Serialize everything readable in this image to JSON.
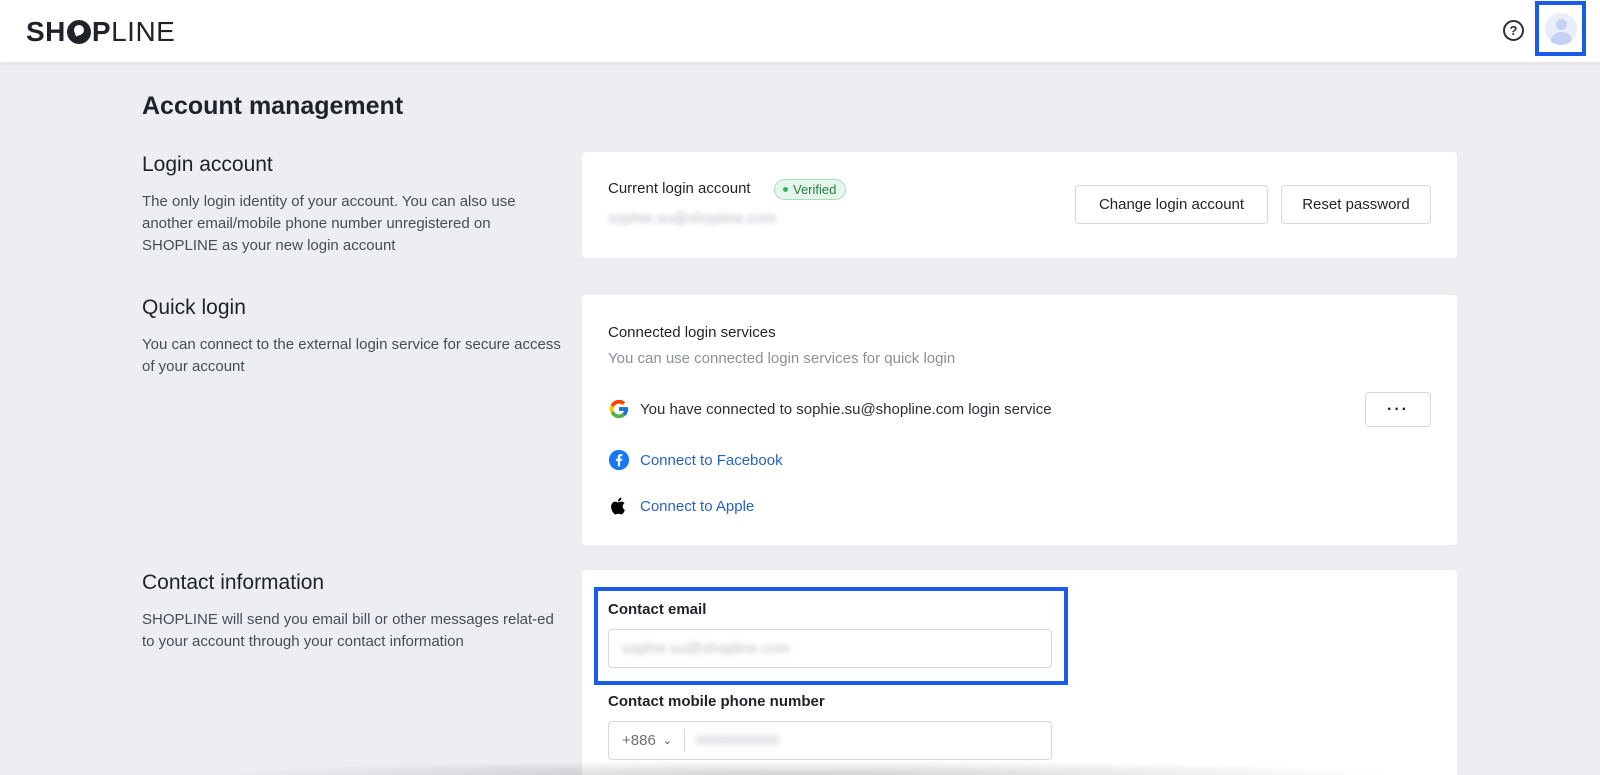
{
  "header": {
    "logo_bold_left": "SH",
    "logo_bold_right": "P",
    "logo_light": "LINE",
    "help_icon_glyph": "?",
    "accent_color": "#1a5ce8"
  },
  "page": {
    "title": "Account management"
  },
  "login_account": {
    "title": "Login account",
    "description": "The only login identity of your account. You can also use another email/mobile phone number unregistered on SHOPLINE as your new login account",
    "current_label": "Current login account",
    "verified_badge": "Verified",
    "email_masked": "sophie.su@shopline.com",
    "change_button": "Change login account",
    "reset_button": "Reset password"
  },
  "quick_login": {
    "title": "Quick login",
    "description": "You can connect to the external login service for secure access of your account",
    "connected_title": "Connected login services",
    "connected_sub": "You can use connected login services for quick login",
    "google_text": "You have connected to sophie.su@shopline.com login service",
    "more_button": "···",
    "facebook_link": "Connect to Facebook",
    "apple_link": "Connect to Apple"
  },
  "contact": {
    "title": "Contact information",
    "description": "SHOPLINE will send you email bill or other messages relat-ed to your account through your contact information",
    "email_label": "Contact email",
    "email_value": "sophie.su@shopline.com",
    "phone_label": "Contact mobile phone number",
    "phone_code": "+886",
    "phone_value": "0000000000"
  }
}
